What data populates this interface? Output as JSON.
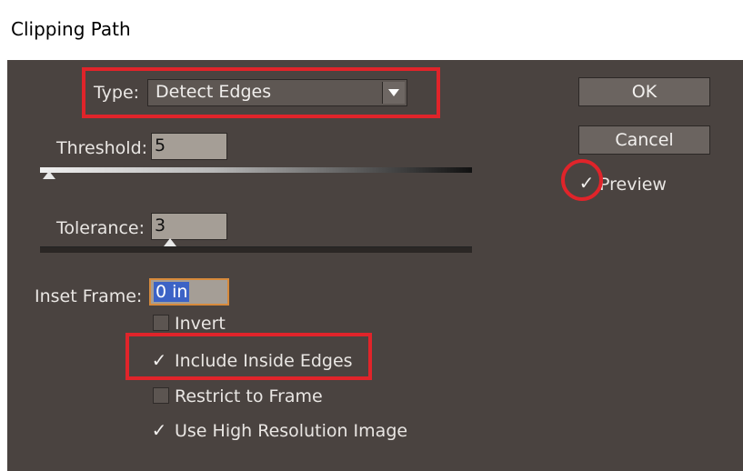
{
  "dialog": {
    "title": "Clipping Path"
  },
  "type": {
    "label": "Type:",
    "value": "Detect Edges"
  },
  "threshold": {
    "label": "Threshold:",
    "value": "5",
    "level": 0.02
  },
  "tolerance": {
    "label": "Tolerance:",
    "value": "3",
    "level": 0.3
  },
  "inset_frame": {
    "label": "Inset Frame:",
    "value": "0 in"
  },
  "options": {
    "invert": {
      "label": "Invert",
      "checked": false
    },
    "include_inside_edges": {
      "label": "Include Inside Edges",
      "checked": true
    },
    "restrict_to_frame": {
      "label": "Restrict to Frame",
      "checked": false
    },
    "use_high_resolution": {
      "label": "Use High Resolution Image",
      "checked": true
    }
  },
  "buttons": {
    "ok": "OK",
    "cancel": "Cancel"
  },
  "preview": {
    "label": "Preview",
    "checked": true
  },
  "colors": {
    "panel_bg": "#4a4340",
    "highlight": "#e0242a",
    "field_bg": "#a59e96"
  },
  "icons": {
    "dropdown": "chevron-down-icon",
    "checkmark": "check-icon"
  }
}
